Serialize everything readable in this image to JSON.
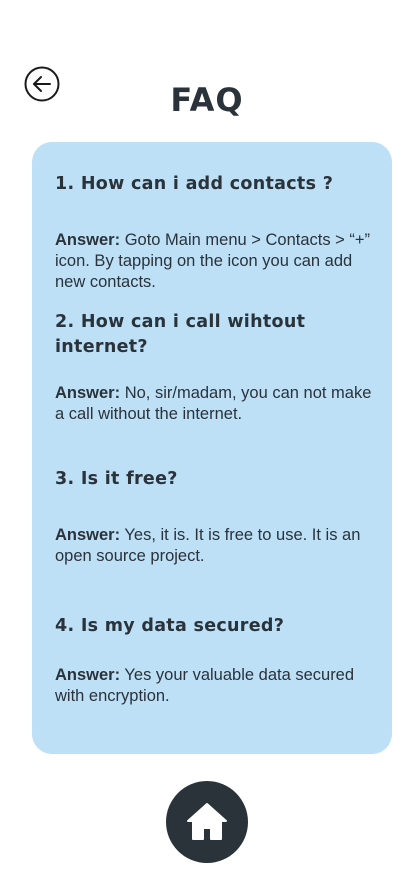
{
  "header": {
    "back_icon": "arrow-left-circle-icon",
    "title": "FAQ"
  },
  "faq": {
    "answer_prefix": "Answer:",
    "items": [
      {
        "question": "1. How can i add contacts ?",
        "answer": "Goto Main menu > Contacts > “+” icon. By tapping on the icon you can add new contacts."
      },
      {
        "question": "2. How can i call wihtout internet?",
        "answer": "No, sir/madam, you can not make a call without the internet."
      },
      {
        "question": "3. Is it free?",
        "answer": "Yes, it is. It is free to use. It is an open source project."
      },
      {
        "question": "4. Is my data secured?",
        "answer": "Yes your valuable data secured with encryption."
      }
    ]
  },
  "footer": {
    "home_icon": "home-icon"
  },
  "colors": {
    "card_background": "#bde0f7",
    "text_dark": "#2a323a",
    "home_button": "#2a323a",
    "page_background": "#ffffff"
  }
}
